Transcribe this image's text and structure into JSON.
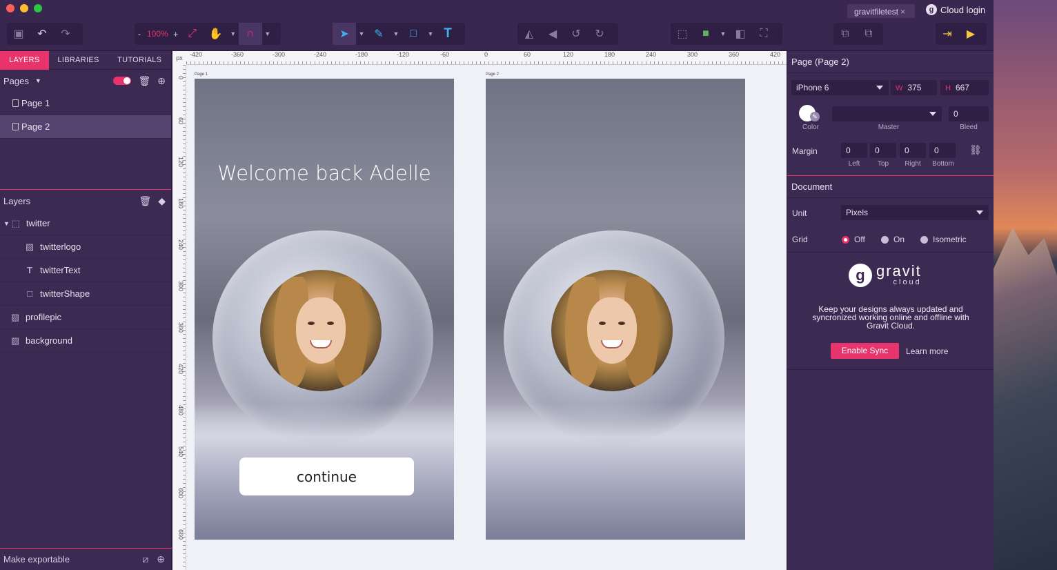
{
  "window": {
    "doc_tab": "gravitfiletest",
    "doc_tab_close": "×",
    "cloud_login": "Cloud login",
    "cloud_badge": "g"
  },
  "toolbar": {
    "zoom": "100%",
    "zoom_minus": "-",
    "zoom_plus": "+"
  },
  "left_panel": {
    "tabs": [
      "LAYERS",
      "LIBRARIES",
      "TUTORIALS"
    ],
    "pages_title": "Pages",
    "pages": [
      "Page 1",
      "Page 2"
    ],
    "layers_title": "Layers",
    "layers": [
      {
        "name": "twitter",
        "icon": "group-icon"
      },
      {
        "name": "twitterlogo",
        "icon": "image-icon"
      },
      {
        "name": "twitterText",
        "icon": "text-icon"
      },
      {
        "name": "twitterShape",
        "icon": "shape-icon"
      },
      {
        "name": "profilepic",
        "icon": "image-icon"
      },
      {
        "name": "background",
        "icon": "image-icon"
      }
    ],
    "footer": "Make exportable"
  },
  "canvas": {
    "ruler_unit": "px",
    "ruler_top": [
      "-420",
      "-360",
      "-300",
      "-240",
      "-180",
      "-120",
      "-60",
      "0",
      "60",
      "120",
      "180",
      "240",
      "300",
      "360",
      "420"
    ],
    "ruler_left": [
      "0",
      "60",
      "120",
      "180",
      "240",
      "300",
      "360",
      "420",
      "480",
      "540",
      "600",
      "660"
    ],
    "artboard1_label": "Page 1",
    "artboard2_label": "Page 2",
    "welcome": "Welcome back Adelle",
    "continue": "continue"
  },
  "right_panel": {
    "title": "Page (Page 2)",
    "device": "iPhone 6",
    "w_label": "W",
    "w": "375",
    "h_label": "H",
    "h": "667",
    "bleed": "0",
    "color_label": "Color",
    "master_label": "Master",
    "bleed_label": "Bleed",
    "margin_label": "Margin",
    "margins": [
      {
        "label": "Left",
        "value": "0"
      },
      {
        "label": "Top",
        "value": "0"
      },
      {
        "label": "Right",
        "value": "0"
      },
      {
        "label": "Bottom",
        "value": "0"
      }
    ],
    "document_title": "Document",
    "unit_label": "Unit",
    "unit": "Pixels",
    "grid_label": "Grid",
    "grid_options": [
      "Off",
      "On",
      "Isometric"
    ],
    "grid_selected": "Off",
    "gravit_word": "gravit",
    "gravit_sub": "cloud",
    "gravit_g": "g",
    "cloud_text": "Keep your designs always updated and syncronized working online and offline with Gravit Cloud.",
    "enable_sync": "Enable Sync",
    "learn_more": "Learn more"
  },
  "colors": {
    "accent": "#e8336d",
    "panel": "#3d2a52",
    "blue_tool": "#3fb0f0"
  }
}
